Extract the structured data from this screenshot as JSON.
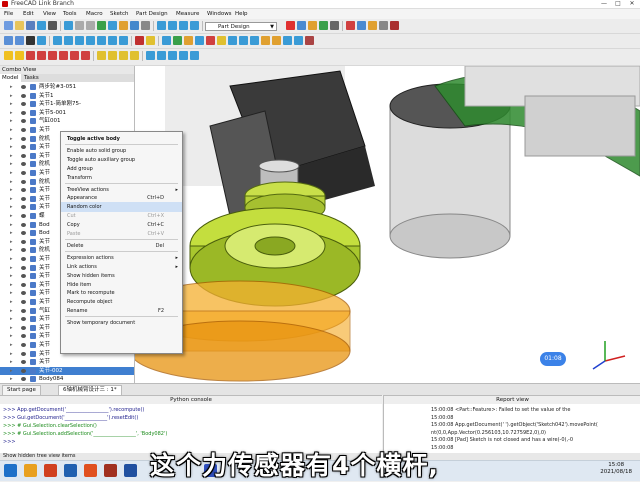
{
  "window": {
    "title": "FreeCAD Link Branch",
    "controls": [
      "—",
      "□",
      "✕"
    ]
  },
  "menu": [
    "File",
    "Edit",
    "View",
    "Tools",
    "Macro",
    "Sketch",
    "Part Design",
    "Measure",
    "Windows",
    "Help"
  ],
  "toolbar": {
    "workbench": "Part Design",
    "workbench_icon": "partdesign-icon"
  },
  "combo_view": {
    "title": "Combo View",
    "tabs": [
      "Model",
      "Tasks"
    ],
    "tree": [
      {
        "label": "两步轮#3-051"
      },
      {
        "label": "关节1"
      },
      {
        "label": "关节1-简单刚75-"
      },
      {
        "label": "关节5-001"
      },
      {
        "label": "气缸001"
      },
      {
        "label": "关节"
      },
      {
        "label": "舵机"
      },
      {
        "label": "关节"
      },
      {
        "label": "关节"
      },
      {
        "label": "舵机"
      },
      {
        "label": "关节"
      },
      {
        "label": "舵机"
      },
      {
        "label": "关节"
      },
      {
        "label": "关节"
      },
      {
        "label": "关节"
      },
      {
        "label": "蝶"
      },
      {
        "label": "Bod"
      },
      {
        "label": "Bod"
      },
      {
        "label": "关节"
      },
      {
        "label": "舵机"
      },
      {
        "label": "关节"
      },
      {
        "label": "关节"
      },
      {
        "label": "关节"
      },
      {
        "label": "关节"
      },
      {
        "label": "关节"
      },
      {
        "label": "关节"
      },
      {
        "label": "气缸"
      },
      {
        "label": "关节"
      },
      {
        "label": "关节"
      },
      {
        "label": "关节"
      },
      {
        "label": "关节"
      },
      {
        "label": "关节"
      },
      {
        "label": "关节"
      },
      {
        "label": "关节-002"
      },
      {
        "label": "Body084"
      }
    ],
    "selected_index": 33
  },
  "context_menu": [
    {
      "label": "Toggle active body",
      "bold": true
    },
    {
      "sep": true
    },
    {
      "label": "Enable auto solid group"
    },
    {
      "label": "Toggle auto auxiliary group"
    },
    {
      "label": "Add group"
    },
    {
      "label": "Transform"
    },
    {
      "sep": true
    },
    {
      "label": "TreeView actions",
      "submenu": true
    },
    {
      "label": "Appearance",
      "shortcut": "Ctrl+D"
    },
    {
      "label": "Random color",
      "highlight": true
    },
    {
      "label": "Cut",
      "shortcut": "Ctrl+X",
      "disabled": true
    },
    {
      "label": "Copy",
      "shortcut": "Ctrl+C"
    },
    {
      "label": "Paste",
      "shortcut": "Ctrl+V",
      "disabled": true
    },
    {
      "sep": true
    },
    {
      "label": "Delete",
      "shortcut": "Del"
    },
    {
      "sep": true
    },
    {
      "label": "Expression actions",
      "submenu": true
    },
    {
      "label": "Link actions",
      "submenu": true
    },
    {
      "label": "Show hidden items"
    },
    {
      "label": "Hide item"
    },
    {
      "label": "Mark to recompute"
    },
    {
      "label": "Recompute object"
    },
    {
      "label": "Rename",
      "shortcut": "F2"
    },
    {
      "sep": true
    },
    {
      "label": "Show temporary document"
    }
  ],
  "bottom_tabs": [
    "Start page",
    "6轴机械臂设计三 : 1*"
  ],
  "python_console": {
    "title": "Python console",
    "lines": [
      {
        "text": ">>> App.getDocument('_________________').recompute()",
        "type": "cmd"
      },
      {
        "text": ">>> Gui.getDocument('_________________').resetEdit()",
        "type": "cmd"
      },
      {
        "text": ">>> # Gui.Selection.clearSelection()",
        "type": "cmt"
      },
      {
        "text": ">>> # Gui.Selection.addSelection('_________________', 'Body082')",
        "type": "cmt"
      },
      {
        "text": ">>>",
        "type": "cmd"
      }
    ]
  },
  "report_view": {
    "title": "Report view",
    "lines": [
      "15:00:08  <Part::Feature>: Failed to set the value of the",
      "15:00:08",
      "15:00:08  App.getDocument(' ').getObject('Sketch042').movePoint(",
      "  nt(0,0,App.Vector(0.256103,10.72759E2,0),0)",
      "15:00:08  [Pad] Sketch is not closed and has a wire(-0),-0",
      "15:00:08"
    ]
  },
  "status_bar": "Show hidden tree view items",
  "overlay": {
    "subtitle": "这个力传感器有4个横杆,",
    "time_badge": "01:08"
  },
  "clock": {
    "time": "15:08",
    "date": "2021/08/18"
  }
}
